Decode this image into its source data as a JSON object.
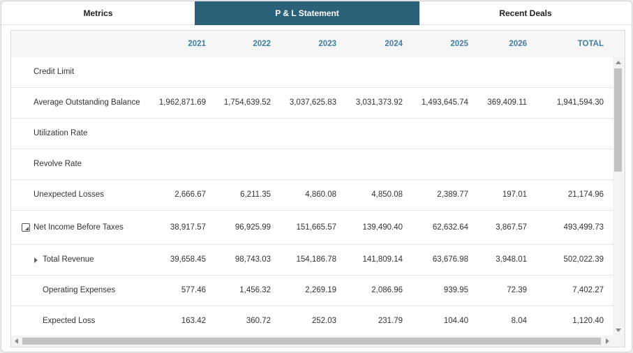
{
  "tabs": [
    {
      "label": "Metrics",
      "active": false
    },
    {
      "label": "P & L Statement",
      "active": true
    },
    {
      "label": "Recent Deals",
      "active": false
    }
  ],
  "columns": [
    "2021",
    "2022",
    "2023",
    "2024",
    "2025",
    "2026",
    "TOTAL"
  ],
  "rows": [
    {
      "label": "Credit Limit",
      "values": [
        "",
        "",
        "",
        "",
        "",
        "",
        ""
      ]
    },
    {
      "label": "Average Outstanding Balance",
      "values": [
        "1,962,871.69",
        "1,754,639.52",
        "3,037,625.83",
        "3,031,373.92",
        "1,493,645.74",
        "369,409.11",
        "1,941,594.30"
      ]
    },
    {
      "label": "Utilization Rate",
      "values": [
        "",
        "",
        "",
        "",
        "",
        "",
        ""
      ]
    },
    {
      "label": "Revolve Rate",
      "values": [
        "",
        "",
        "",
        "",
        "",
        "",
        ""
      ]
    },
    {
      "label": "Unexpected Losses",
      "values": [
        "2,666.67",
        "6,211.35",
        "4,860.08",
        "4,850.08",
        "2,389.77",
        "197.01",
        "21,174.96"
      ]
    },
    {
      "label": "Net Income Before Taxes",
      "values": [
        "38,917.57",
        "96,925.99",
        "151,665.57",
        "139,490.40",
        "62,632.64",
        "3,867.57",
        "493,499.73"
      ],
      "icon": "collapse-icon"
    },
    {
      "label": "Total Revenue",
      "values": [
        "39,658.45",
        "98,743.03",
        "154,186.78",
        "141,809.14",
        "63,676.98",
        "3,948.01",
        "502,022.39"
      ],
      "icon": "expand-caret-icon"
    },
    {
      "label": "Operating Expenses",
      "values": [
        "577.46",
        "1,456.32",
        "2,269.19",
        "2,086.96",
        "939.95",
        "72.39",
        "7,402.27"
      ]
    },
    {
      "label": "Expected Loss",
      "values": [
        "163.42",
        "360.72",
        "252.03",
        "231.79",
        "104.40",
        "8.04",
        "1,120.40"
      ]
    }
  ],
  "colors": {
    "accent": "#2b6279",
    "header_text": "#3f7ea3"
  }
}
